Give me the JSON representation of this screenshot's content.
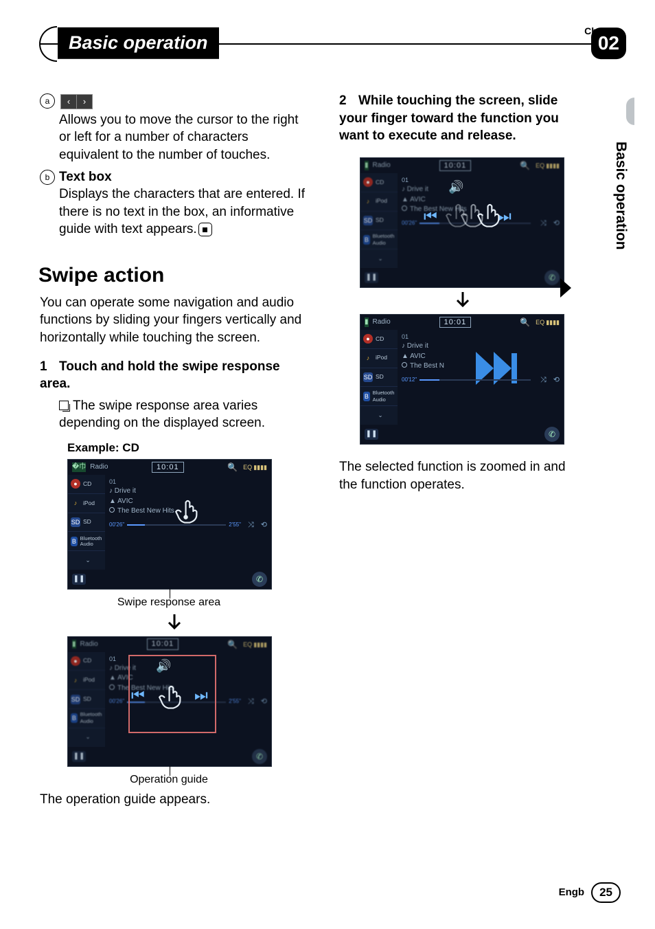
{
  "chapter": {
    "label": "Chapter",
    "number": "02",
    "title": "Basic operation"
  },
  "side_tab": "Basic operation",
  "left": {
    "item10": {
      "num": "a",
      "desc": "Allows you to move the cursor to the right or left for a number of characters equivalent to the number of touches."
    },
    "item11": {
      "num": "b",
      "title": "Text box",
      "desc": "Displays the characters that are entered. If there is no text in the box, an informative guide with text appears."
    },
    "swipe": {
      "heading": "Swipe action",
      "intro": "You can operate some navigation and audio functions by sliding your fingers vertically and horizontally while touching the screen.",
      "step1_num": "1",
      "step1": "Touch and hold the swipe response area.",
      "note1": "The swipe response area varies depending on the displayed screen.",
      "example_label": "Example: CD",
      "caption1": "Swipe response area",
      "caption2": "Operation guide",
      "after": "The operation guide appears."
    }
  },
  "right": {
    "step2_num": "2",
    "step2": "While touching the screen, slide your finger toward the function you want to execute and release.",
    "after": "The selected function is zoomed in and the function operates."
  },
  "shot_a": {
    "clock": "10:01",
    "eq": "EQ",
    "side": [
      "Radio",
      "CD",
      "iPod",
      "SD",
      "Bluetooth Audio"
    ],
    "track_num": "01",
    "tracks": [
      "Drive it",
      "AVIC",
      "The Best New Hits"
    ],
    "prog_left": "00'26\"",
    "prog_right": "2'55\""
  },
  "shot_d": {
    "clock": "10:01",
    "eq": "EQ",
    "side": [
      "Radio",
      "CD",
      "iPod",
      "SD",
      "Bluetooth Audio"
    ],
    "track_num": "01",
    "tracks": [
      "Drive it",
      "AVIC",
      "The Best N"
    ],
    "prog_left": "00'12\""
  },
  "footer": {
    "lang": "Engb",
    "page": "25"
  }
}
